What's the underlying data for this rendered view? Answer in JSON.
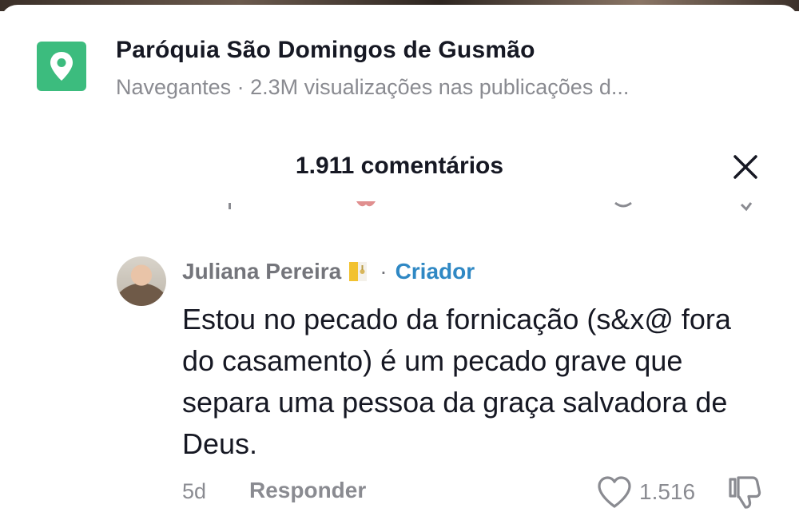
{
  "location": {
    "title": "Paróquia São Domingos de Gusmão",
    "subtitle": "Navegantes · 2.3M visualizações nas publicações d...",
    "icon": "location-pin-icon",
    "icon_color": "#3cbc7e"
  },
  "comments_header": {
    "title": "1.911 comentários",
    "close_icon": "close-icon"
  },
  "comment": {
    "author": "Juliana Pereira",
    "flag_icon": "vatican-flag-icon",
    "separator": "·",
    "badge": "Criador",
    "badge_color": "#2f88c4",
    "text": "Estou no pecado da fornicação (s&x@ fora do casamento) é um pecado grave que separa uma pessoa da graça salvadora de Deus.",
    "time": "5d",
    "reply_label": "Responder",
    "like_count": "1.516",
    "like_icon": "heart-icon",
    "dislike_icon": "thumbs-down-icon"
  }
}
